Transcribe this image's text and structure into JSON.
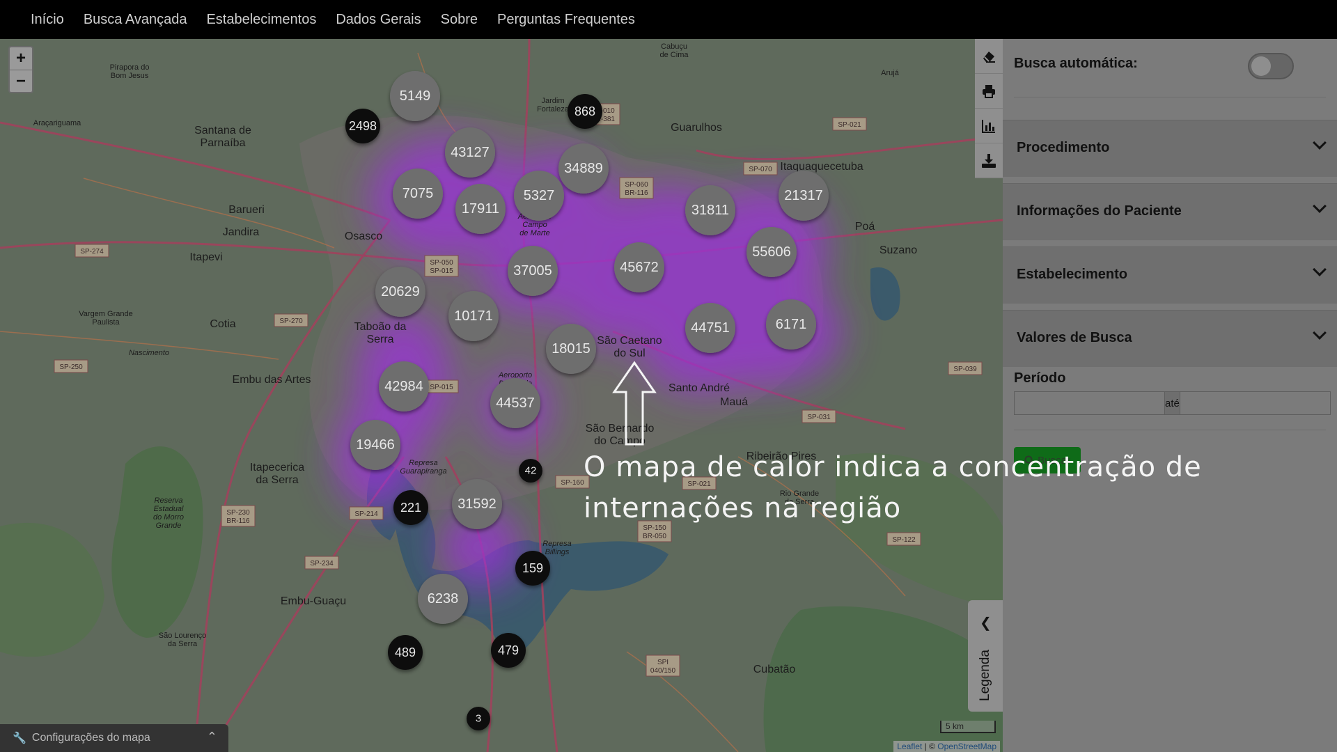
{
  "navbar": {
    "items": [
      "Início",
      "Busca Avançada",
      "Estabelecimentos",
      "Dados Gerais",
      "Sobre",
      "Perguntas Frequentes"
    ]
  },
  "map": {
    "zoom_in_label": "+",
    "zoom_out_label": "−",
    "place_labels": [
      "Guarulhos",
      "Itaquaquecetuba",
      "Santana de Parnaíba",
      "Barueri",
      "Osasco",
      "Jandira",
      "Itapevi",
      "Cotia",
      "Vargem Grande Paulista",
      "Taboão da Serra",
      "Embu das Artes",
      "Itapecerica da Serra",
      "São Caetano do Sul",
      "Santo André",
      "São Bernardo do Campo",
      "Mauá",
      "Ribeirão Pires",
      "Suzano",
      "Poá",
      "Arujá",
      "Cubatão",
      "Embu-Guaçu",
      "São Lourenço da Serra",
      "Pirapora do Bom Jesus",
      "Araçariguama",
      "Jardim Fortaleza",
      "Cabuçu de Cima",
      "Rio Grande da Serra",
      "Reserva Estadual do Morro Grande",
      "Represa Billings",
      "Represa Guarapiranga",
      "Aeroporto Campo de Marte",
      "Aeroporto Deputado",
      "Nascimento"
    ],
    "clusters": [
      {
        "value": "5149",
        "kind": "large"
      },
      {
        "value": "2498",
        "kind": "small"
      },
      {
        "value": "868",
        "kind": "small"
      },
      {
        "value": "43127",
        "kind": "large"
      },
      {
        "value": "34889",
        "kind": "large"
      },
      {
        "value": "7075",
        "kind": "large"
      },
      {
        "value": "17911",
        "kind": "large"
      },
      {
        "value": "5327",
        "kind": "large"
      },
      {
        "value": "31811",
        "kind": "large"
      },
      {
        "value": "21317",
        "kind": "large"
      },
      {
        "value": "55606",
        "kind": "large"
      },
      {
        "value": "37005",
        "kind": "large"
      },
      {
        "value": "45672",
        "kind": "large"
      },
      {
        "value": "20629",
        "kind": "large"
      },
      {
        "value": "10171",
        "kind": "large"
      },
      {
        "value": "44751",
        "kind": "large"
      },
      {
        "value": "6171",
        "kind": "large"
      },
      {
        "value": "18015",
        "kind": "large"
      },
      {
        "value": "42984",
        "kind": "large"
      },
      {
        "value": "44537",
        "kind": "large"
      },
      {
        "value": "19466",
        "kind": "large"
      },
      {
        "value": "42",
        "kind": "tiny"
      },
      {
        "value": "221",
        "kind": "small"
      },
      {
        "value": "31592",
        "kind": "large"
      },
      {
        "value": "159",
        "kind": "small"
      },
      {
        "value": "6238",
        "kind": "large"
      },
      {
        "value": "489",
        "kind": "small"
      },
      {
        "value": "479",
        "kind": "small"
      },
      {
        "value": "3",
        "kind": "tiny"
      }
    ],
    "road_shields": [
      "SP-010 BR-381",
      "SP-021",
      "SP-070",
      "SP-060 BR-116",
      "SP-274",
      "SP-050 SP-015",
      "SP-270",
      "SP-250",
      "SP-015",
      "SP-160",
      "SP-021",
      "SP-150 BR-050",
      "SP-230 BR-116",
      "SP-214",
      "SP-234",
      "SP-031",
      "SP-039",
      "SP-122",
      "SPI 040/150"
    ],
    "scale_label": "5 km",
    "attribution": {
      "leaflet": "Leaflet",
      "separator": " | © ",
      "osm": "OpenStreetMap"
    },
    "settings_label": "Configurações do mapa",
    "toolbar_icons": [
      "eraser-icon",
      "print-icon",
      "chart-icon",
      "download-icon"
    ],
    "legend_label": "Legenda"
  },
  "sidebar": {
    "auto_search_label": "Busca automática:",
    "auto_search_on": false,
    "sections": [
      "Procedimento",
      "Informações do Paciente",
      "Estabelecimento",
      "Valores de Busca"
    ],
    "periodo_label": "Período",
    "periodo_start": "",
    "periodo_sep": "até",
    "periodo_end": "",
    "search_button": "Buscar"
  },
  "tutorial": {
    "text": "O mapa de calor indica a concentração de internações na região"
  },
  "colors": {
    "heat": "#9b30d9",
    "cluster_large": "#6e6e6e",
    "cluster_small": "#111111",
    "button_green": "#0f6b18"
  }
}
